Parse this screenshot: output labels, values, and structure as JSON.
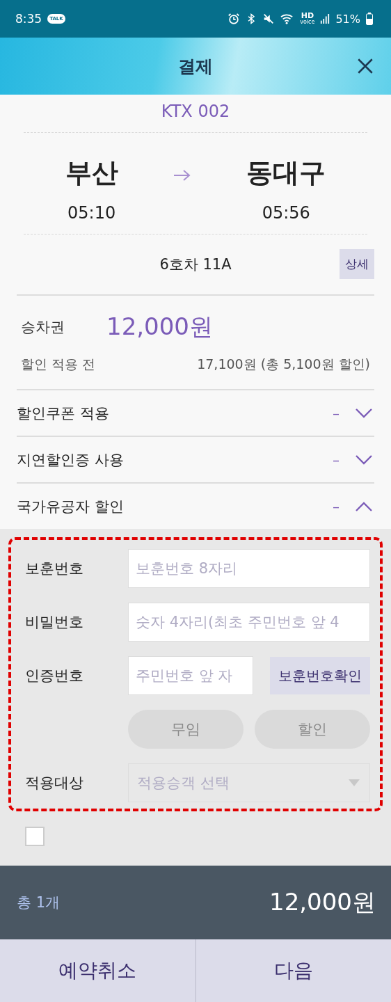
{
  "status_bar": {
    "time": "8:35",
    "chat_badge": "TALK",
    "hd": "HD",
    "voice": "voice",
    "battery": "51%"
  },
  "header": {
    "title": "결제"
  },
  "train": {
    "name": "KTX 002",
    "from": "부산",
    "to": "동대구",
    "depart": "05:10",
    "arrive": "05:56",
    "seat": "6호차 11A",
    "detail_button": "상세"
  },
  "ticket": {
    "label": "승차권",
    "price": "12,000원",
    "before_label": "할인 적용 전",
    "before_value": "17,100원 (총 5,100원 할인)"
  },
  "discounts": [
    {
      "label": "할인쿠폰 적용",
      "value": "–",
      "expanded": false
    },
    {
      "label": "지연할인증 사용",
      "value": "–",
      "expanded": false
    },
    {
      "label": "국가유공자 할인",
      "value": "–",
      "expanded": true
    }
  ],
  "form": {
    "fields": [
      {
        "label": "보훈번호",
        "placeholder": "보훈번호 8자리"
      },
      {
        "label": "비밀번호",
        "placeholder": "숫자 4자리(최초 주민번호 앞 4"
      }
    ],
    "cert": {
      "label": "인증번호",
      "placeholder": "주민번호 앞 자",
      "button": "보훈번호확인"
    },
    "options": [
      {
        "label": "무임",
        "disabled": true
      },
      {
        "label": "할인",
        "disabled": true
      }
    ],
    "target": {
      "label": "적용대상",
      "placeholder": "적용승객 선택"
    }
  },
  "agreement": {
    "checked": false
  },
  "summary": {
    "count": "총 1개",
    "total": "12,000원"
  },
  "actions": [
    "예약취소",
    "다음"
  ]
}
